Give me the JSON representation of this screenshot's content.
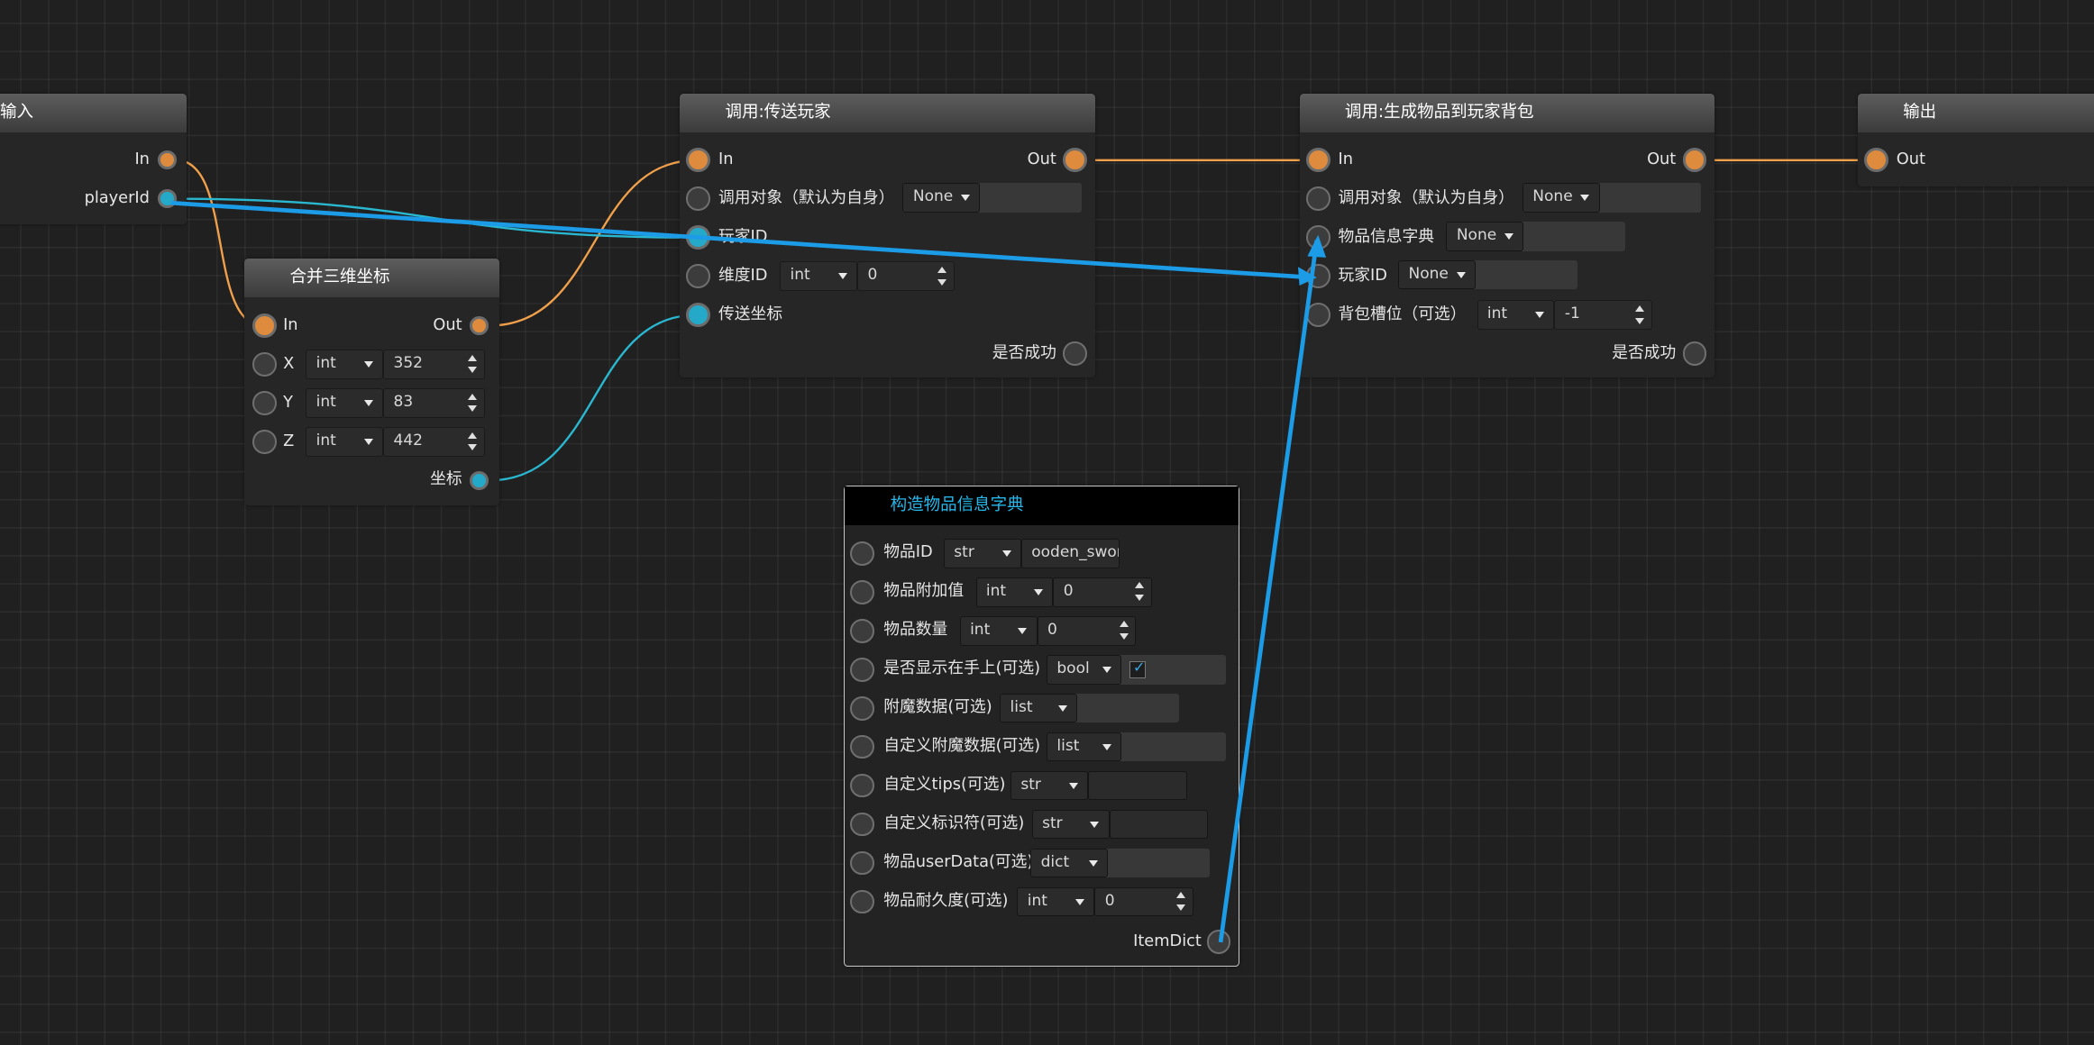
{
  "nodes": {
    "input": {
      "title": "输入",
      "in_label": "In",
      "player_label": "playerId"
    },
    "combine": {
      "title": "合并三维坐标",
      "in_label": "In",
      "out_label": "Out",
      "x_label": "X",
      "y_label": "Y",
      "z_label": "Z",
      "x_type": "int",
      "y_type": "int",
      "z_type": "int",
      "x_value": "352",
      "y_value": "83",
      "z_value": "442",
      "coord_label": "坐标"
    },
    "teleport": {
      "title": "调用:传送玩家",
      "in_label": "In",
      "out_label": "Out",
      "target_label": "调用对象（默认为自身）",
      "target_value": "None",
      "player_label": "玩家ID",
      "dim_label": "维度ID",
      "dim_type": "int",
      "dim_value": "0",
      "pos_label": "传送坐标",
      "success_label": "是否成功"
    },
    "spawn": {
      "title": "调用:生成物品到玩家背包",
      "in_label": "In",
      "out_label": "Out",
      "target_label": "调用对象（默认为自身）",
      "target_value": "None",
      "dict_label": "物品信息字典",
      "dict_value": "None",
      "player_label": "玩家ID",
      "player_value": "None",
      "slot_label": "背包槽位（可选）",
      "slot_type": "int",
      "slot_value": "-1",
      "success_label": "是否成功"
    },
    "output": {
      "title": "输出",
      "out_label": "Out"
    },
    "itemdict": {
      "title": "构造物品信息字典",
      "rows": [
        {
          "label": "物品ID",
          "type": "str",
          "value": "ooden_sword"
        },
        {
          "label": "物品附加值",
          "type": "int",
          "value": "0"
        },
        {
          "label": "物品数量",
          "type": "int",
          "value": "0"
        },
        {
          "label": "是否显示在手上(可选)",
          "type": "bool",
          "value": "✓"
        },
        {
          "label": "附魔数据(可选)",
          "type": "list",
          "value": ""
        },
        {
          "label": "自定义附魔数据(可选)",
          "type": "list",
          "value": ""
        },
        {
          "label": "自定义tips(可选)",
          "type": "str",
          "value": ""
        },
        {
          "label": "自定义标识符(可选)",
          "type": "str",
          "value": ""
        },
        {
          "label": "物品userData(可选)",
          "type": "dict",
          "value": ""
        },
        {
          "label": "物品耐久度(可选)",
          "type": "int",
          "value": "0"
        }
      ],
      "out_label": "ItemDict"
    }
  },
  "colors": {
    "exec_wire": "#f0a04b",
    "data_wire": "#2ab7d0",
    "drag_wire": "#1c9be6",
    "background": "#202020",
    "selected_title": "#26b7ea"
  }
}
